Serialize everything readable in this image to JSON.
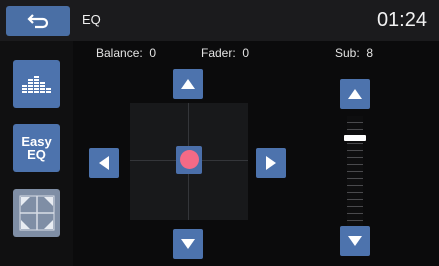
{
  "header": {
    "title": "EQ",
    "clock": "01:24"
  },
  "icons": {
    "back": "return-arrow-icon",
    "eq": "equalizer-bars-icon",
    "easy_eq": "easy-eq-icon",
    "position": "position-cross-icon",
    "up": "up-arrow-icon",
    "down": "down-arrow-icon",
    "left": "left-arrow-icon",
    "right": "right-arrow-icon"
  },
  "sidebar": {
    "easy_eq_line1": "Easy",
    "easy_eq_line2": "EQ"
  },
  "readouts": {
    "balance_label": "Balance:",
    "balance_value": "0",
    "fader_label": "Fader:",
    "fader_value": "0",
    "sub_label": "Sub:",
    "sub_value": "8"
  },
  "sub_slider": {
    "level_fraction": 0.8
  },
  "colors": {
    "accent": "#4d73ad",
    "knob": "#f46a86",
    "inactive": "#7f8ea5"
  }
}
